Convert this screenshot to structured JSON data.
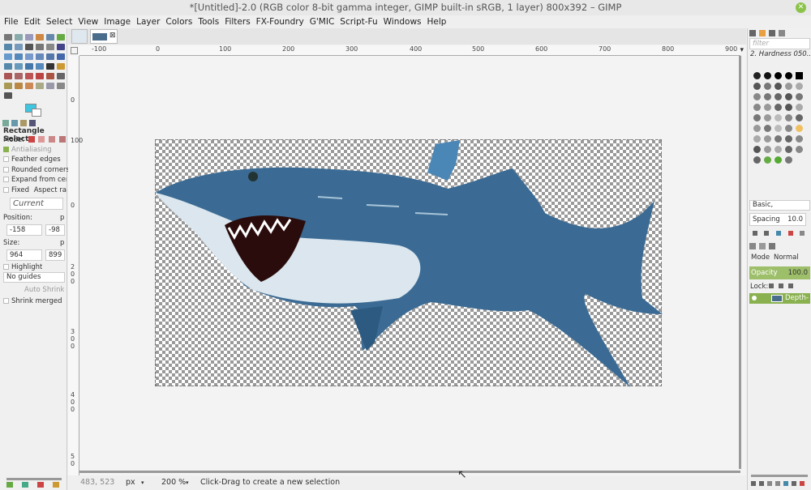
{
  "window": {
    "title": "*[Untitled]-2.0 (RGB color 8-bit gamma integer, GIMP built-in sRGB, 1 layer) 800x392 – GIMP"
  },
  "menu": [
    "File",
    "Edit",
    "Select",
    "View",
    "Image",
    "Layer",
    "Colors",
    "Tools",
    "Filters",
    "FX-Foundry",
    "G'MIC",
    "Script-Fu",
    "Windows",
    "Help"
  ],
  "tool_options": {
    "title": "Rectangle Select",
    "mode_label": "Mode:",
    "antialiasing": "Antialiasing",
    "feather_edges": "Feather edges",
    "rounded_corners": "Rounded corners",
    "expand_from_center": "Expand from cen",
    "fixed_label": "Fixed",
    "fixed_value": "Aspect rat",
    "current_placeholder": "Current",
    "position_label": "Position:",
    "position_unit": "p",
    "position_x": "-158",
    "position_y": "-98",
    "size_label": "Size:",
    "size_unit": "p",
    "size_w": "964",
    "size_h": "899",
    "highlight": "Highlight",
    "guides": "No guides",
    "auto_shrink": "Auto Shrink",
    "shrink_merged": "Shrink merged"
  },
  "colors": {
    "foreground": "#3fc5df",
    "background": "#ffffff",
    "accent": "#8ab14f"
  },
  "ruler": {
    "h_ticks": [
      "-100",
      "0",
      "100",
      "200",
      "300",
      "400",
      "500",
      "600",
      "700",
      "800",
      "900"
    ],
    "v_ticks": [
      "0",
      "100",
      "0",
      "2 0 0",
      "3 0 0",
      "4 0 0",
      "5 0"
    ]
  },
  "status": {
    "coords": "483, 523",
    "unit": "px",
    "zoom": "200 %",
    "message": "Click-Drag to create a new selection"
  },
  "brushes": {
    "filter_placeholder": "filter",
    "current": "2. Hardness 050...",
    "preset": "Basic,",
    "spacing_label": "Spacing",
    "spacing_value": "10.0"
  },
  "layers": {
    "mode_label": "Mode",
    "mode_value": "Normal",
    "opacity_label": "Opacity",
    "opacity_value": "100.0",
    "lock_label": "Lock:",
    "layer_name": "Depth-"
  }
}
